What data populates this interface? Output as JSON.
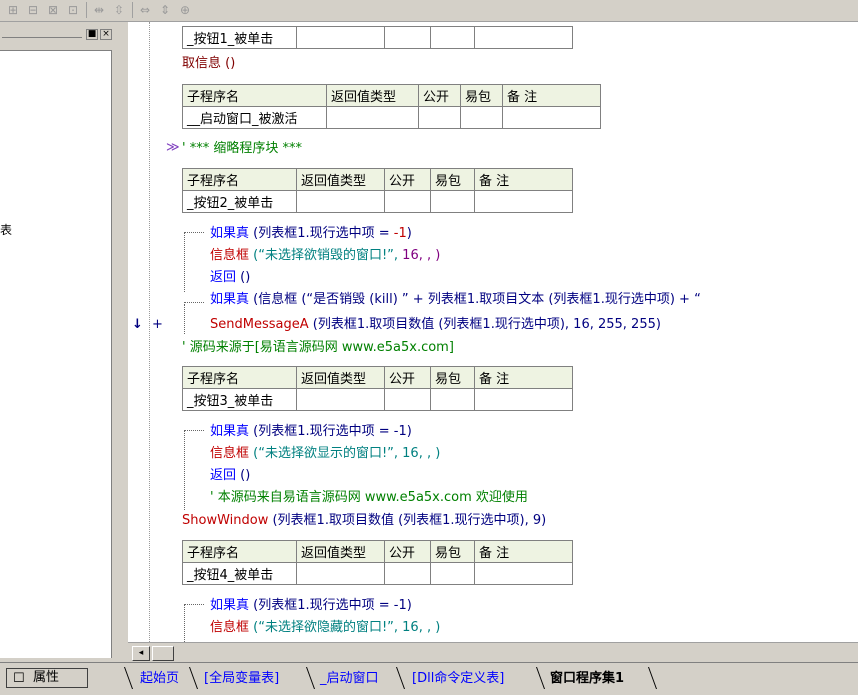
{
  "toolbar": {
    "icons": [
      "table-insert-icon",
      "table-merge-icon",
      "table-split-icon",
      "column-insert-icon",
      "column-width-icon",
      "row-height-icon",
      "align-horizontal-icon",
      "align-vertical-icon",
      "grid-icon"
    ]
  },
  "left_panel": {
    "close_glyph": "×",
    "min_glyph": "■",
    "text": "表"
  },
  "colors": {
    "keyword": "#0000ff",
    "method": "#c00000",
    "teal": "#008080",
    "comment": "#008000",
    "header_bg": "#eef3e2"
  },
  "editor": {
    "top_sub": "_按钮1_被单击",
    "line_getinfo": "取信息 ()",
    "header_cols": [
      "子程序名",
      "返回值类型",
      "公开",
      "易包",
      "备 注"
    ],
    "sub_activate": "__启动窗口_被激活",
    "collapsed_marker": "≫",
    "collapsed_block": "' *** 缩略程序块 ***",
    "sub2": "_按钮2_被单击",
    "sub2_lines": [
      {
        "k": "如果真",
        "r": " (列表框1.现行选中项 = ",
        "n": "-1",
        ")": ")"
      },
      {
        "k": "信息框",
        "r": " (“未选择欲销毁的窗口!”, 16, , )"
      },
      {
        "k": "返回",
        "r": " ()"
      },
      {
        "k": "如果真",
        "r": " (信息框 (“是否销毁 (kill) ” + 列表框1.取项目文本 (列表框1.现行选中项) + “"
      },
      {
        "k": "SendMessageA",
        "r": " (列表框1.取项目数值 (列表框1.现行选中项), 16, 255, 255)"
      },
      {
        "k": "",
        "r": "' 源码来源于[易语言源码网 www.e5a5x.com]"
      }
    ],
    "sub3": "_按钮3_被单击",
    "sub3_lines": [
      {
        "k": "如果真",
        "r": " (列表框1.现行选中项 = -1)"
      },
      {
        "k": "信息框",
        "r": " (“未选择欲显示的窗口!”, 16, , )"
      },
      {
        "k": "返回",
        "r": " ()"
      },
      {
        "k": "",
        "r": "' 本源码来自易语言源码网 www.e5a5x.com  欢迎使用"
      },
      {
        "k": "ShowWindow",
        "r": " (列表框1.取项目数值 (列表框1.现行选中项), 9)"
      }
    ],
    "sub4": "_按钮4_被单击",
    "sub4_lines": [
      {
        "k": "如果真",
        "r": " (列表框1.现行选中项 = -1)"
      },
      {
        "k": "信息框",
        "r": " (“未选择欲隐藏的窗口!”, 16, , )"
      }
    ],
    "gutter": {
      "arrow": "↓",
      "plus": "+"
    }
  },
  "scrollbar": {
    "left_arrow": "◂"
  },
  "tabs": {
    "property_label": "属性",
    "items": [
      "起始页",
      "[全局变量表]",
      "_启动窗口",
      "[Dll命令定义表]",
      "窗口程序集1"
    ],
    "active_index": 4
  }
}
